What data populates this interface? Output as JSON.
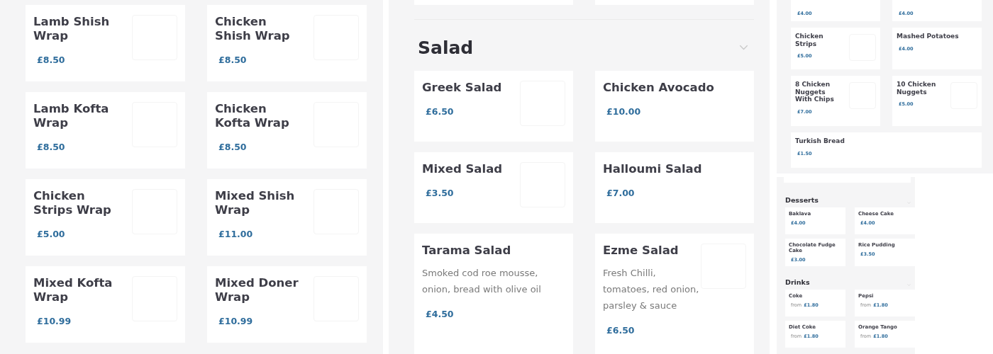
{
  "wraps": {
    "items": [
      {
        "name": "Lamb Shish Wrap",
        "price": "£8.50",
        "image": true
      },
      {
        "name": "Chicken Shish Wrap",
        "price": "£8.50",
        "image": true
      },
      {
        "name": "Lamb Kofta Wrap",
        "price": "£8.50",
        "image": true
      },
      {
        "name": "Chicken Kofta Wrap",
        "price": "£8.50",
        "image": true
      },
      {
        "name": "Chicken Strips Wrap",
        "price": "£5.00",
        "image": true
      },
      {
        "name": "Mixed Shish Wrap",
        "price": "£11.00",
        "image": true
      },
      {
        "name": "Mixed Kofta Wrap",
        "price": "£10.99",
        "image": true
      },
      {
        "name": "Mixed Doner Wrap",
        "price": "£10.99",
        "image": true
      }
    ]
  },
  "salad": {
    "title": "Salad",
    "items": [
      {
        "name": "Greek Salad",
        "price": "£6.50",
        "image": true
      },
      {
        "name": "Chicken Avocado",
        "price": "£10.00",
        "image": false
      },
      {
        "name": "Mixed Salad",
        "price": "£3.50",
        "image": true
      },
      {
        "name": "Halloumi Salad",
        "price": "£7.00",
        "image": false
      },
      {
        "name": "Tarama Salad",
        "description": "Smoked cod roe mousse, onion, bread with olive oil",
        "price": "£4.50",
        "image": false
      },
      {
        "name": "Ezme Salad",
        "description": "Fresh Chilli, tomatoes, red onion, parsley & sauce",
        "price": "£6.50",
        "image": true
      }
    ]
  },
  "sides": {
    "items": [
      {
        "price": "£4.00",
        "image": false
      },
      {
        "price": "£4.00",
        "image": false
      },
      {
        "name": "Chicken Strips",
        "price": "£5.00",
        "image": true
      },
      {
        "name": "Mashed Potatoes",
        "price": "£4.00",
        "image": false
      },
      {
        "name": "8 Chicken Nuggets With Chips",
        "price": "£7.00",
        "image": true
      },
      {
        "name": "10 Chicken Nuggets",
        "price": "£5.00",
        "image": true
      },
      {
        "name": "Turkish Bread",
        "price": "£1.50",
        "image": false,
        "wide": true
      }
    ]
  },
  "categories": [
    {
      "title": "Desserts",
      "items": [
        {
          "name": "Baklava",
          "price": "£4.00"
        },
        {
          "name": "Cheese Cake",
          "price": "£4.00"
        },
        {
          "name": "Chocolate Fudge Cake",
          "price": "£3.00"
        },
        {
          "name": "Rice Pudding",
          "price": "£3.50"
        }
      ]
    },
    {
      "title": "Drinks",
      "items": [
        {
          "name": "Coke",
          "price_prefix": "from",
          "price": "£1.80"
        },
        {
          "name": "Pepsi",
          "price_prefix": "from",
          "price": "£1.80"
        },
        {
          "name": "Diet Coke",
          "price_prefix": "from",
          "price": "£1.80"
        },
        {
          "name": "Orange Tango",
          "price_prefix": "from",
          "price": "£1.80"
        }
      ]
    }
  ]
}
